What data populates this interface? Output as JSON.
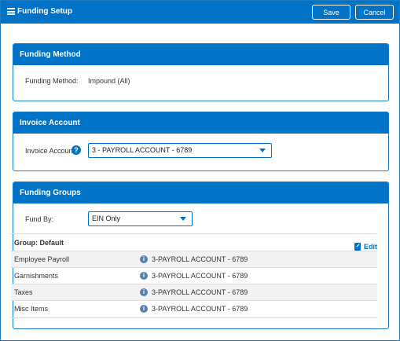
{
  "header": {
    "title": "Funding Setup",
    "save_label": "Save",
    "cancel_label": "Cancel"
  },
  "funding_method": {
    "heading": "Funding Method",
    "label": "Funding Method:",
    "value": "Impound (All)"
  },
  "invoice_account": {
    "heading": "Invoice Account",
    "label": "Invoice Account:",
    "help_glyph": "?",
    "selected": "3 - PAYROLL ACCOUNT - 6789"
  },
  "funding_groups": {
    "heading": "Funding Groups",
    "fund_by_label": "Fund By:",
    "fund_by_selected": "EIN Only",
    "group_label": "Group: Default",
    "edit_label": "Edit",
    "info_glyph": "i",
    "rows": [
      {
        "name": "Employee Payroll",
        "account": "3-PAYROLL ACCOUNT - 6789"
      },
      {
        "name": "Garnishments",
        "account": "3-PAYROLL ACCOUNT - 6789"
      },
      {
        "name": "Taxes",
        "account": "3-PAYROLL ACCOUNT - 6789"
      },
      {
        "name": "Misc Items",
        "account": "3-PAYROLL ACCOUNT - 6789"
      }
    ]
  },
  "colors": {
    "accent": "#0073c6",
    "info_icon": "#5a7fa8",
    "row_shade": "#f2f2f2"
  }
}
